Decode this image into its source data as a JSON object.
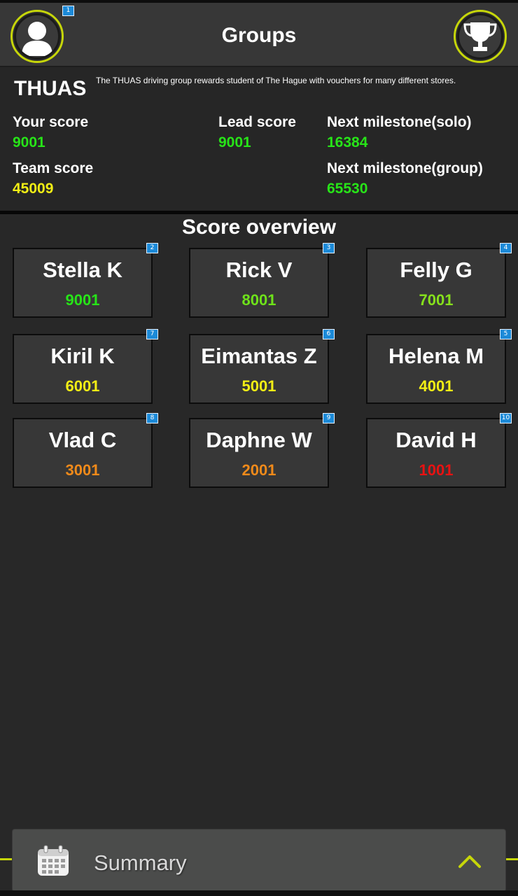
{
  "header": {
    "title": "Groups",
    "profile_icon": "user-avatar-icon",
    "trophy_icon": "trophy-icon",
    "markers": {
      "profile": "1"
    }
  },
  "group": {
    "name": "THUAS",
    "description": "The THUAS driving group rewards student of The Hague with vouchers for many different stores."
  },
  "stats": {
    "your_score_label": "Your score",
    "your_score": "9001",
    "lead_score_label": "Lead score",
    "lead_score": "9001",
    "next_solo_label": "Next milestone(solo)",
    "next_solo": "16384",
    "team_score_label": "Team score",
    "team_score": "45009",
    "next_group_label": "Next milestone(group)",
    "next_group": "65530"
  },
  "overview": {
    "title": "Score overview",
    "members": [
      {
        "name": "Stella K",
        "score": "9001",
        "marker": "2",
        "color": "#27e418"
      },
      {
        "name": "Rick V",
        "score": "8001",
        "marker": "3",
        "color": "#6ee21a"
      },
      {
        "name": "Felly G",
        "score": "7001",
        "marker": "4",
        "color": "#86e01c"
      },
      {
        "name": "Kiril K",
        "score": "6001",
        "marker": "7",
        "color": "#f2ee15"
      },
      {
        "name": "Eimantas Z",
        "score": "5001",
        "marker": "6",
        "color": "#f2ee15"
      },
      {
        "name": "Helena M",
        "score": "4001",
        "marker": "5",
        "color": "#f2ee15"
      },
      {
        "name": "Vlad C",
        "score": "3001",
        "marker": "8",
        "color": "#f08a1a"
      },
      {
        "name": "Daphne W",
        "score": "2001",
        "marker": "9",
        "color": "#f08a1a"
      },
      {
        "name": "David H",
        "score": "1001",
        "marker": "10",
        "color": "#e81212"
      }
    ]
  },
  "summary": {
    "label": "Summary",
    "icon": "calendar-icon",
    "chevron": "chevron-up-icon"
  },
  "colors": {
    "accent": "#c6d60a",
    "green": "#27e418",
    "yellow": "#f2ee15",
    "orange": "#f08a1a",
    "red": "#e81212",
    "background": "#282828",
    "card": "#373737"
  }
}
